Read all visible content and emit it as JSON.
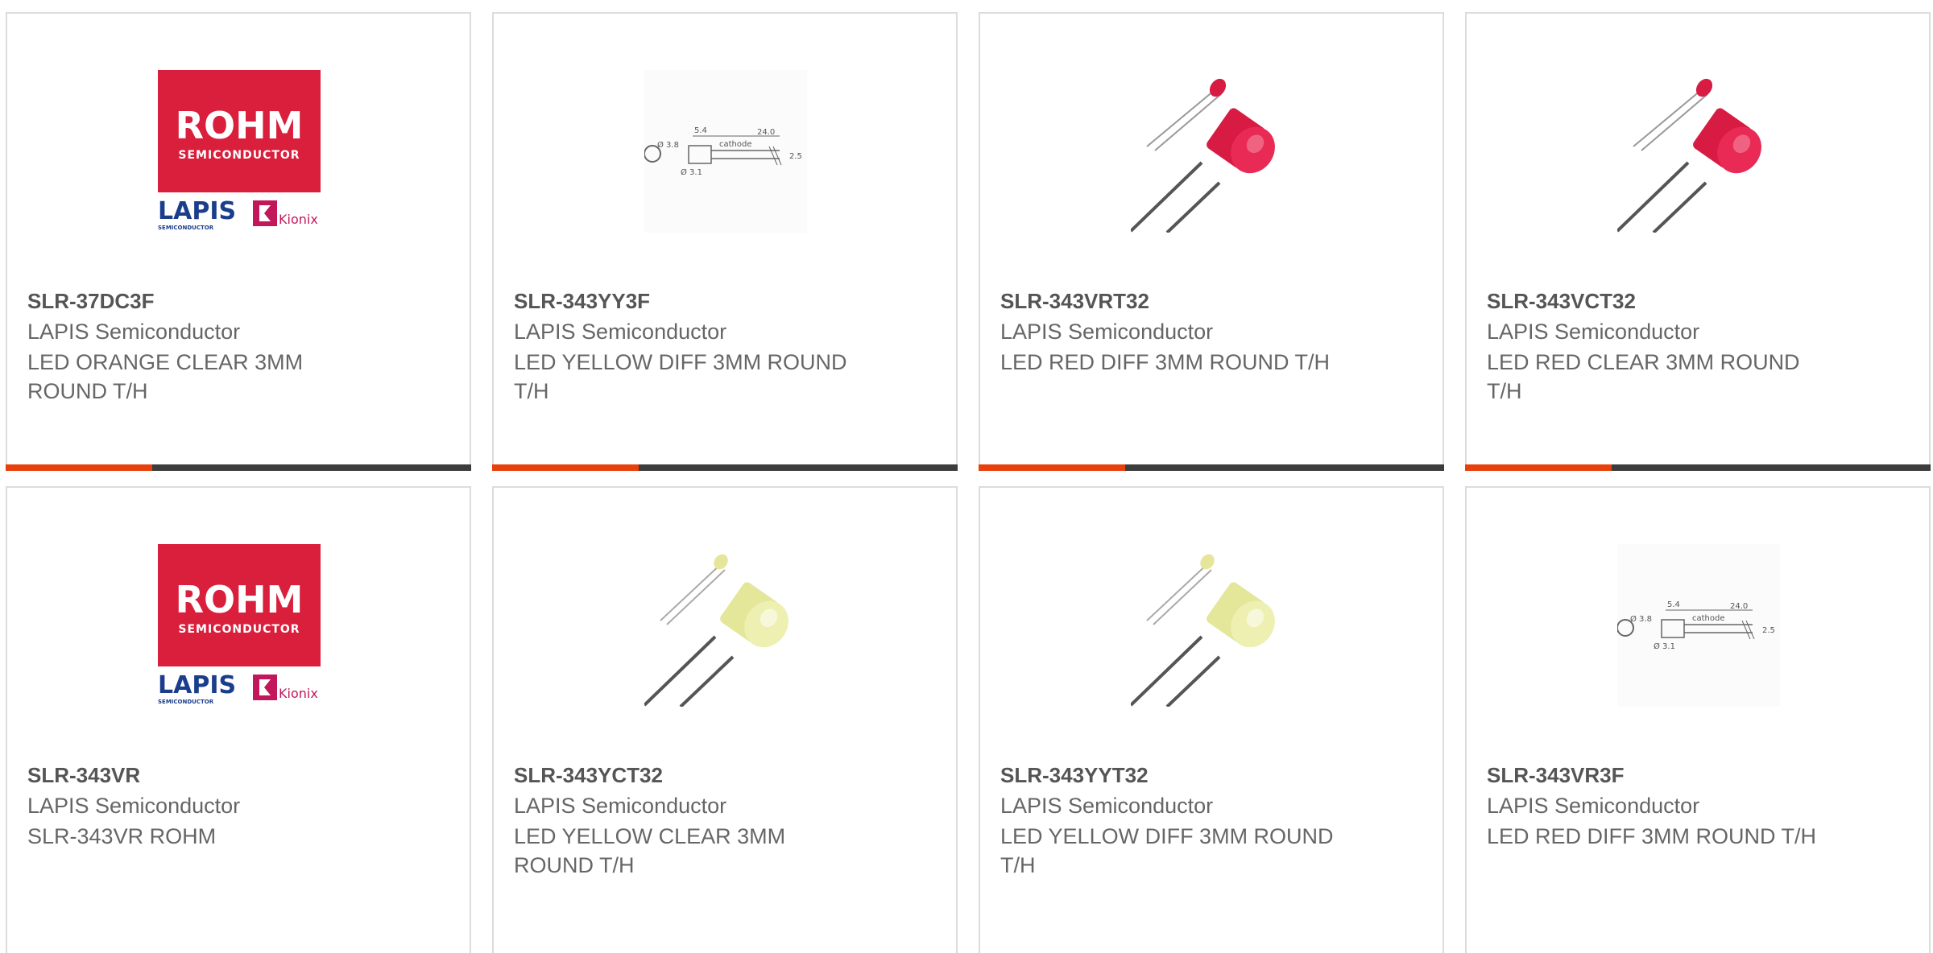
{
  "colors": {
    "accent": "#e8400c",
    "bar": "#3c3c3c",
    "rohm_red": "#d91f3c",
    "lapis_blue": "#1a3d8c",
    "kionix_magenta": "#c2185b"
  },
  "products": [
    {
      "part_number": "SLR-37DC3F",
      "manufacturer": "LAPIS Semiconductor",
      "description": "LED ORANGE CLEAR 3MM ROUND T/H",
      "image": "rohm-lapis-kionix-logo",
      "logo": {
        "brand": "ROHM",
        "sub": "SEMICONDUCTOR",
        "lapis": "LAPIS",
        "lapis_sub": "SEMICONDUCTOR",
        "kionix": "Kionix"
      }
    },
    {
      "part_number": "SLR-343YY3F",
      "manufacturer": "LAPIS Semiconductor",
      "description": "LED YELLOW DIFF 3MM ROUND T/H",
      "image": "dimension-drawing",
      "drawing": {
        "d1": "Ø 3.8",
        "d2": "5.4",
        "d3": "24.0",
        "d4": "cathode",
        "d5": "Ø 3.1",
        "d6": "2.5"
      }
    },
    {
      "part_number": "SLR-343VRT32",
      "manufacturer": "LAPIS Semiconductor",
      "description": "LED RED DIFF 3MM ROUND T/H",
      "image": "led-red-photo"
    },
    {
      "part_number": "SLR-343VCT32",
      "manufacturer": "LAPIS Semiconductor",
      "description": "LED RED CLEAR 3MM ROUND T/H",
      "image": "led-red-photo"
    },
    {
      "part_number": "SLR-343VR",
      "manufacturer": "LAPIS Semiconductor",
      "description": "SLR-343VR ROHM",
      "image": "rohm-lapis-kionix-logo",
      "logo": {
        "brand": "ROHM",
        "sub": "SEMICONDUCTOR",
        "lapis": "LAPIS",
        "lapis_sub": "SEMICONDUCTOR",
        "kionix": "Kionix"
      }
    },
    {
      "part_number": "SLR-343YCT32",
      "manufacturer": "LAPIS Semiconductor",
      "description": "LED YELLOW CLEAR 3MM ROUND T/H",
      "image": "led-yellow-photo"
    },
    {
      "part_number": "SLR-343YYT32",
      "manufacturer": "LAPIS Semiconductor",
      "description": "LED YELLOW DIFF 3MM ROUND T/H",
      "image": "led-yellow-photo"
    },
    {
      "part_number": "SLR-343VR3F",
      "manufacturer": "LAPIS Semiconductor",
      "description": "LED RED DIFF 3MM ROUND T/H",
      "image": "dimension-drawing",
      "drawing": {
        "d1": "Ø 3.8",
        "d2": "5.4",
        "d3": "24.0",
        "d4": "cathode",
        "d5": "Ø 3.1",
        "d6": "2.5"
      }
    }
  ]
}
